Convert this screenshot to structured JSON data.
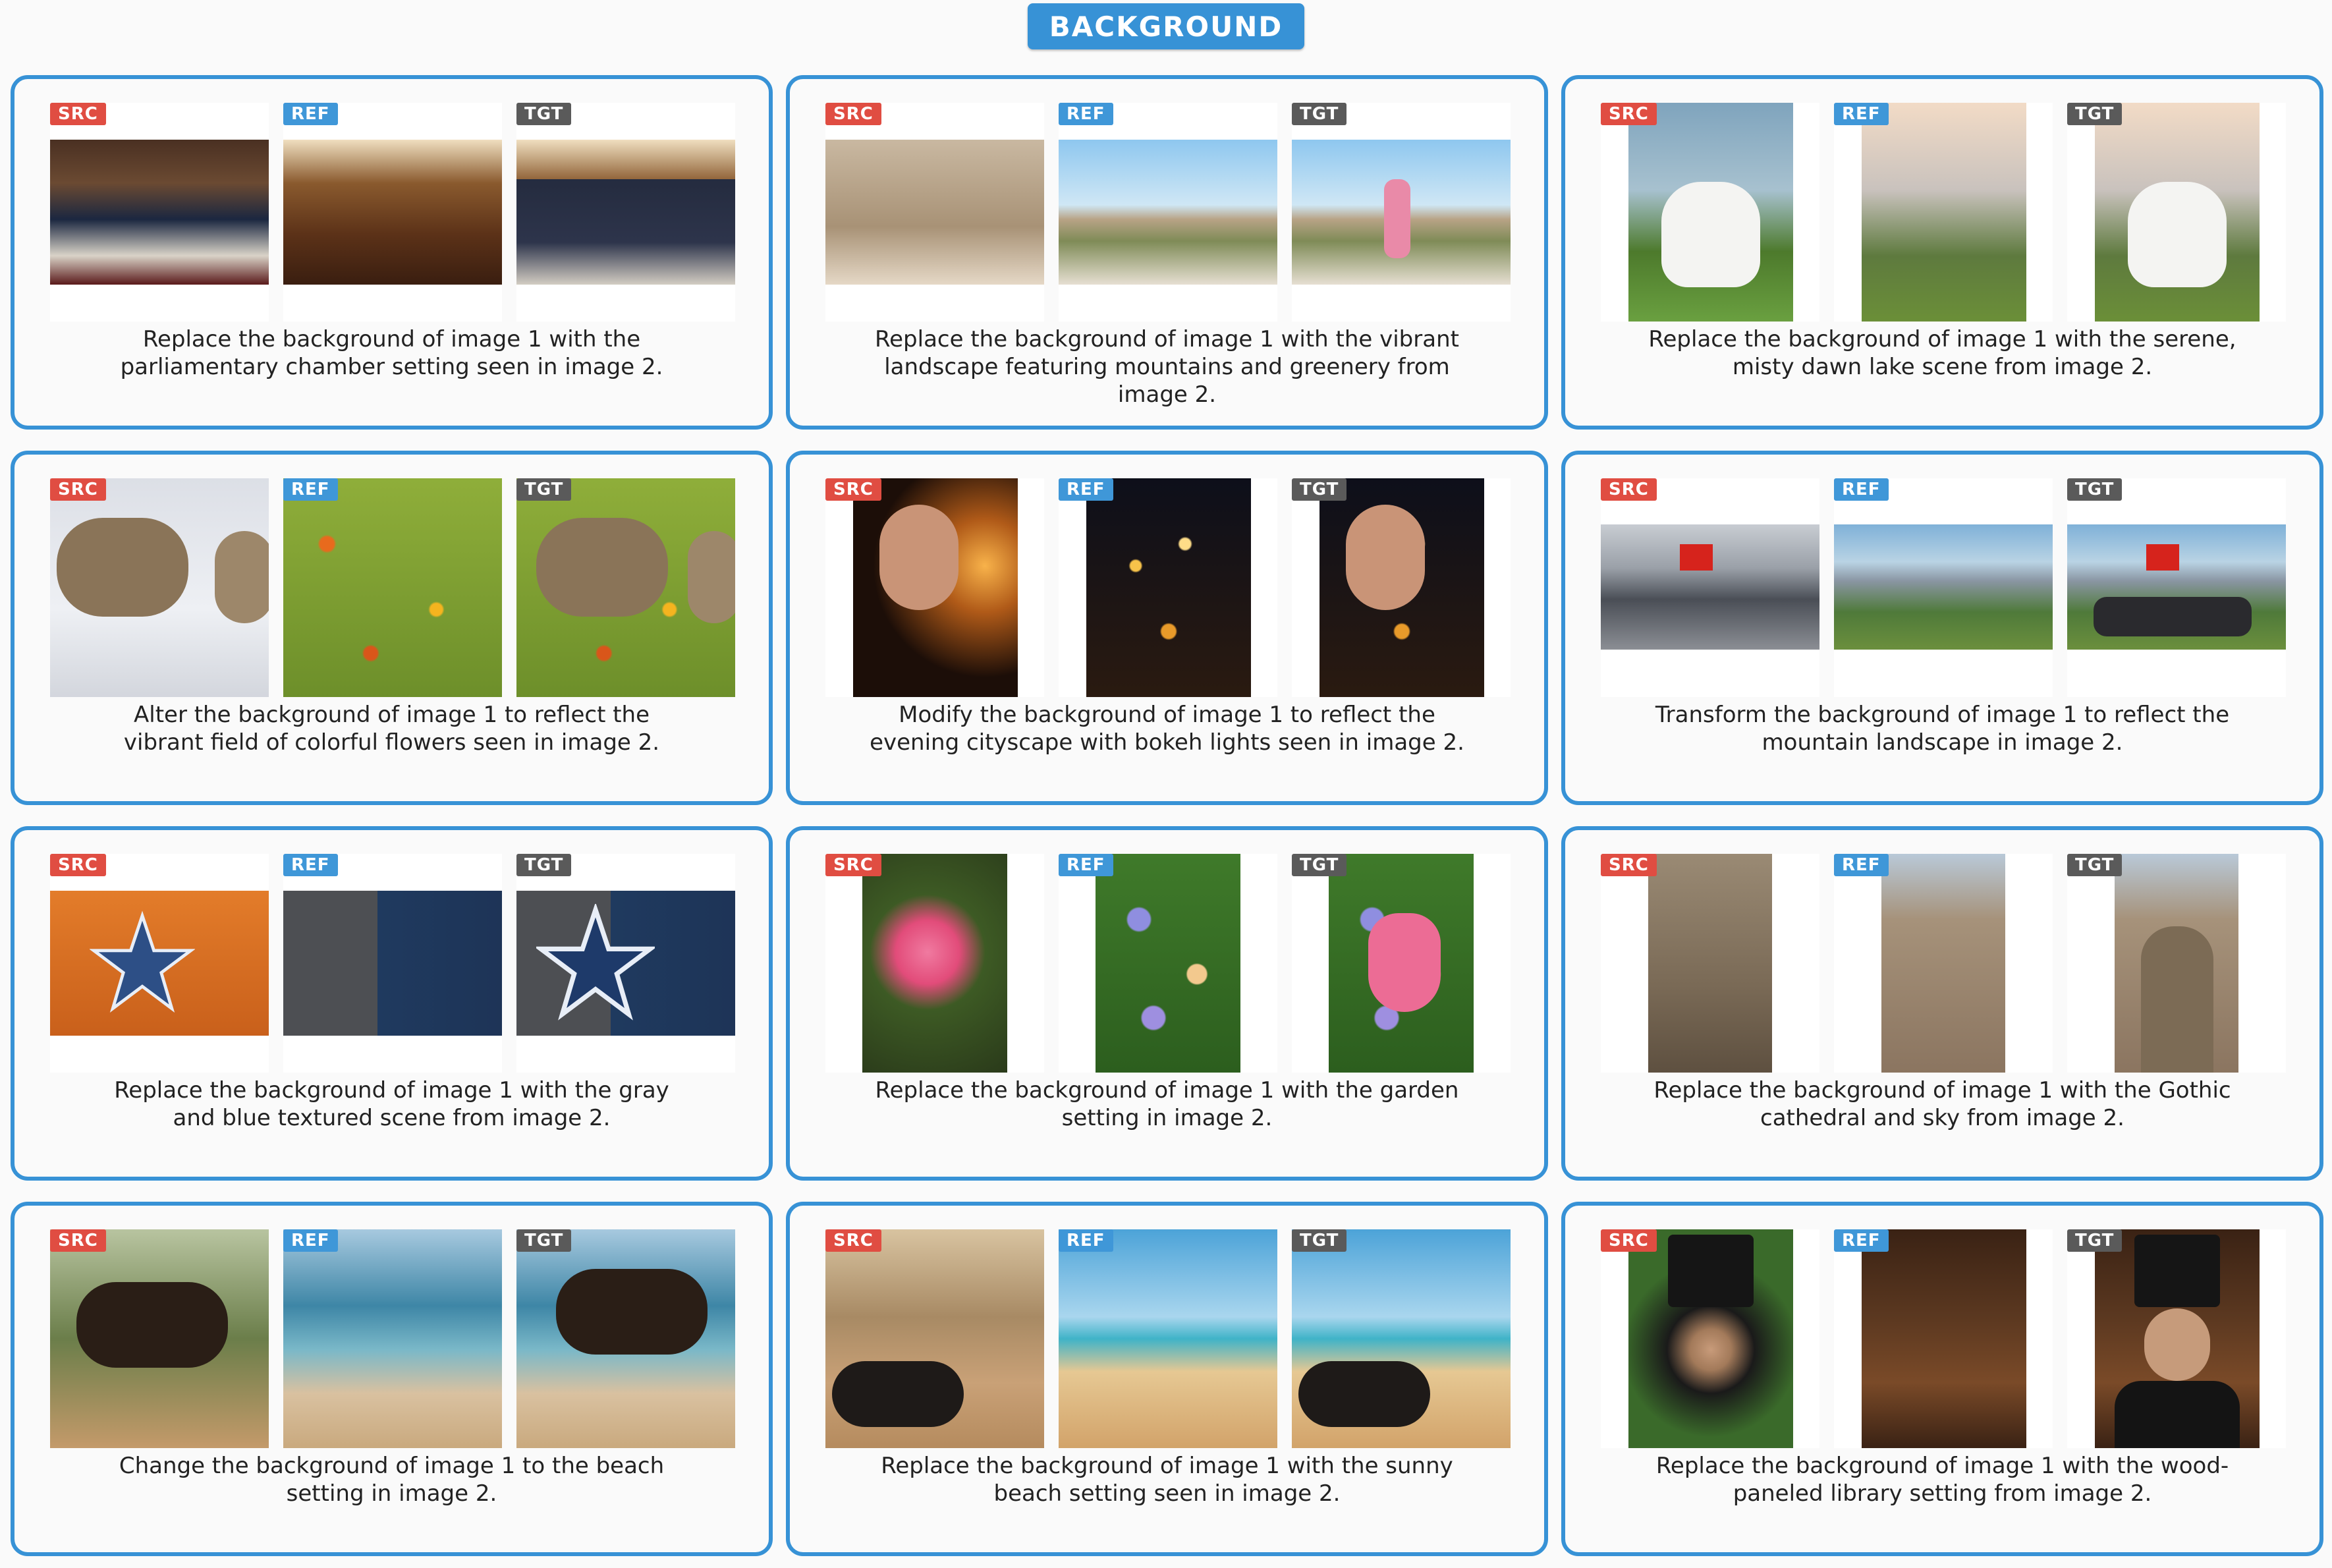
{
  "title": "BACKGROUND",
  "labels": {
    "src": "SRC",
    "ref": "REF",
    "tgt": "TGT"
  },
  "cards": [
    {
      "caption": "Replace the background of image 1 with the parliamentary chamber setting seen in image 2."
    },
    {
      "caption": "Replace the background of image 1 with the vibrant landscape featuring mountains and greenery from image 2."
    },
    {
      "caption": "Replace the background of image 1 with the serene, misty dawn lake scene from image 2."
    },
    {
      "caption": "Alter the background of image 1 to reflect the vibrant field of colorful flowers seen in image 2."
    },
    {
      "caption": "Modify the background of image 1 to reflect the evening cityscape with bokeh lights seen in image 2."
    },
    {
      "caption": "Transform the background of image 1 to reflect the mountain landscape in image 2."
    },
    {
      "caption": "Replace the background of image 1 with the gray and blue textured scene from image 2."
    },
    {
      "caption": "Replace the background of image 1 with the garden setting in image 2."
    },
    {
      "caption": "Replace the background of image 1 with the Gothic cathedral and sky from image 2."
    },
    {
      "caption": "Change the background of image 1 to the beach setting in image 2."
    },
    {
      "caption": "Replace the background of image 1 with the sunny beach setting seen in image 2."
    },
    {
      "caption": "Replace the background of image 1 with the wood-paneled library setting from image 2."
    }
  ]
}
